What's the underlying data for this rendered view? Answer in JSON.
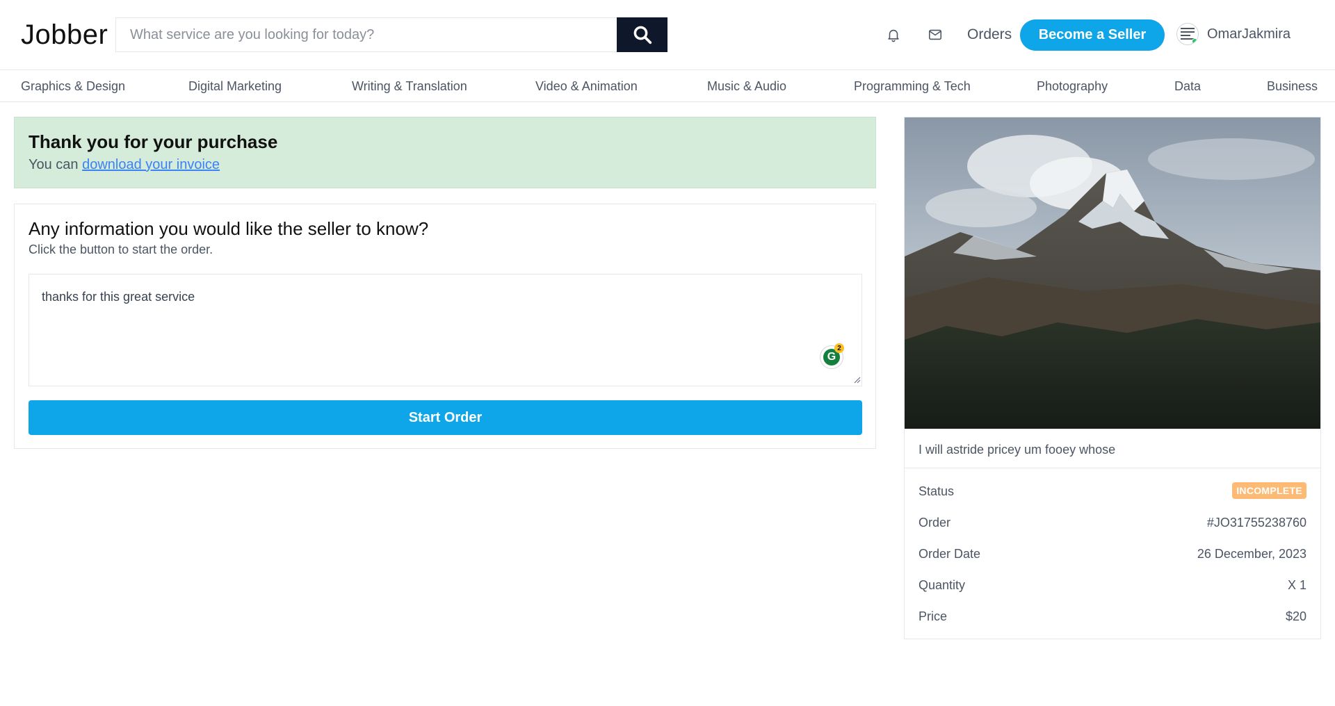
{
  "header": {
    "logo": "Jobber",
    "search_placeholder": "What service are you looking for today?",
    "orders_label": "Orders",
    "become_seller_label": "Become a Seller",
    "username": "OmarJakmira"
  },
  "categories": [
    "Graphics & Design",
    "Digital Marketing",
    "Writing & Translation",
    "Video & Animation",
    "Music & Audio",
    "Programming & Tech",
    "Photography",
    "Data",
    "Business"
  ],
  "thanks": {
    "title": "Thank you for your purchase",
    "prefix": "You can ",
    "link_label": "download your invoice"
  },
  "info": {
    "title": "Any information you would like the seller to know?",
    "subtitle": "Click the button to start the order.",
    "textarea_value": "thanks for this great service",
    "grammarly_count": "2",
    "start_button_label": "Start Order"
  },
  "order_card": {
    "gig_title": "I will astride pricey um fooey whose",
    "rows": [
      {
        "label": "Status",
        "value": "INCOMPLETE"
      },
      {
        "label": "Order",
        "value": "#JO31755238760"
      },
      {
        "label": "Order Date",
        "value": "26 December, 2023"
      },
      {
        "label": "Quantity",
        "value": "X 1"
      },
      {
        "label": "Price",
        "value": "$20"
      }
    ]
  },
  "colors": {
    "accent": "#0ea5e9",
    "dark": "#0f172a",
    "success_bg": "#d4ecd9",
    "status_badge": "#fdba74",
    "link": "#3b82f6"
  }
}
